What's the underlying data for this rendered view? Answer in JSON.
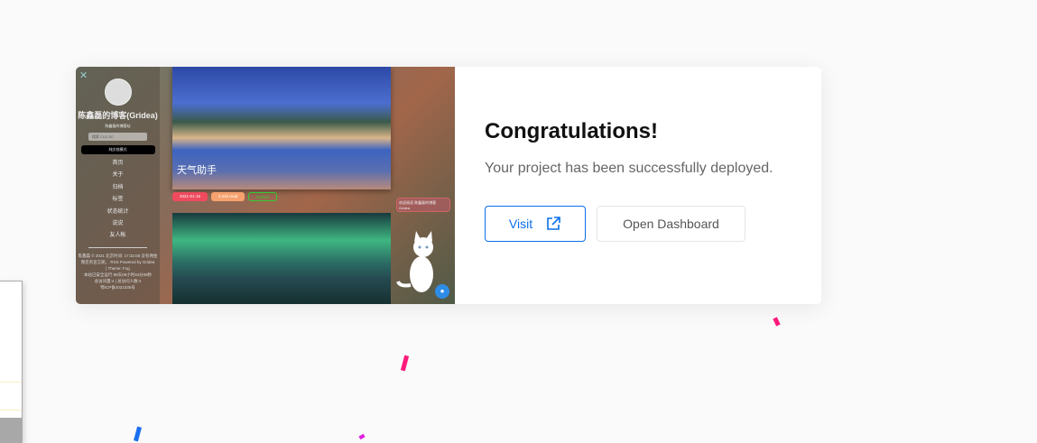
{
  "dialog": {
    "title": "Congratulations!",
    "message": "Your project has been successfully deployed.",
    "visit_label": "Visit",
    "dashboard_label": "Open Dashboard"
  },
  "preview": {
    "blog_title": "陈鑫磊的博客(Gridea)",
    "blog_subtitle": "陈鑫磊的博客站",
    "search_placeholder": "搜索 CLD-SC",
    "side_button": "纯文档模式",
    "nav": [
      "首页",
      "关于",
      "归档",
      "标签",
      "状态统计",
      "说说",
      "友人帐"
    ],
    "footer": [
      "陈鑫磊 © 2021 北京时间: 17:32:08 没有佣金",
      "我还有宣言呢。 RSS Powered by Gridea",
      "| Theme: Fog",
      "本站已安全运行 89天08小时32分08秒",
      "总访问量:4 | 总访问人数:4",
      "鄂ICP备2021035号"
    ],
    "post_title": "天气助手",
    "post_date": "2021-01-15",
    "post_read": "3 min read",
    "post_tag": "Python",
    "welcome": "欢迎阅读 陈鑫磊的博客 Gridea"
  },
  "colors": {
    "accent": "#0a70e8",
    "confetti_pink": "#ff1a7a",
    "confetti_blue": "#1a6ff0",
    "confetti_magenta": "#e020e0"
  }
}
